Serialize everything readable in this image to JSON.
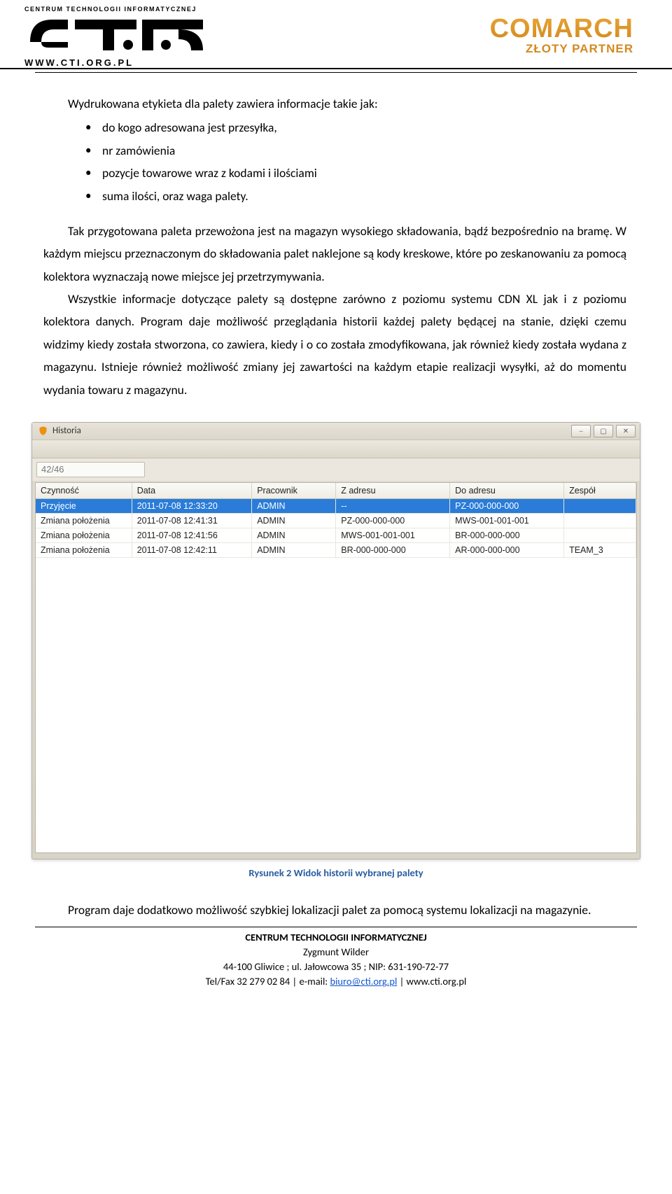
{
  "header": {
    "left_top": "CENTRUM TECHNOLOGII INFORMATYCZNEJ",
    "left_bottom": "WWW.CTI.ORG.PL",
    "right_brand": "COMARCH",
    "right_sub": "ZŁOTY PARTNER"
  },
  "body": {
    "p1": "Wydrukowana etykieta dla palety zawiera informacje takie jak:",
    "bullets": [
      "do kogo adresowana jest przesyłka,",
      "nr zamówienia",
      "pozycje towarowe wraz z kodami i ilościami",
      "suma ilości, oraz waga palety."
    ],
    "p2": "Tak przygotowana paleta przewożona jest na magazyn wysokiego składowania, bądź bezpośrednio na bramę. W każdym miejscu przeznaczonym do składowania palet naklejone są kody kreskowe, które po zeskanowaniu za pomocą kolektora wyznaczają nowe miejsce jej przetrzymywania.",
    "p3": "Wszystkie informacje dotyczące palety są dostępne zarówno z poziomu systemu CDN XL jak i z poziomu kolektora danych. Program daje możliwość przeglądania historii każdej palety będącej na stanie, dzięki czemu widzimy kiedy została stworzona, co zawiera, kiedy i o co została zmodyfikowana, jak również kiedy została wydana z magazynu. Istnieje również możliwość zmiany jej zawartości na każdym etapie realizacji wysyłki, aż do momentu wydania towaru z magazynu."
  },
  "window": {
    "title": "Historia",
    "filter_value": "42/46",
    "columns": [
      "Czynność",
      "Data",
      "Pracownik",
      "Z adresu",
      "Do adresu",
      "Zespół"
    ],
    "rows": [
      {
        "sel": true,
        "cells": [
          "Przyjęcie",
          "2011-07-08 12:33:20",
          "ADMIN",
          "--",
          "PZ-000-000-000",
          ""
        ]
      },
      {
        "sel": false,
        "cells": [
          "Zmiana położenia",
          "2011-07-08 12:41:31",
          "ADMIN",
          "PZ-000-000-000",
          "MWS-001-001-001",
          ""
        ]
      },
      {
        "sel": false,
        "cells": [
          "Zmiana położenia",
          "2011-07-08 12:41:56",
          "ADMIN",
          "MWS-001-001-001",
          "BR-000-000-000",
          ""
        ]
      },
      {
        "sel": false,
        "cells": [
          "Zmiana położenia",
          "2011-07-08 12:42:11",
          "ADMIN",
          "BR-000-000-000",
          "AR-000-000-000",
          "TEAM_3"
        ]
      }
    ],
    "caption": "Rysunek 2 Widok historii wybranej palety"
  },
  "after": {
    "p": "Program daje dodatkowo możliwość szybkiej lokalizacji palet za pomocą systemu lokalizacji na magazynie."
  },
  "footer": {
    "l1": "CENTRUM TECHNOLOGII INFORMATYCZNEJ",
    "l2": "Zygmunt Wilder",
    "l3": "44-100 Gliwice ; ul. Jałowcowa 35 ; NIP: 631-190-72-77",
    "l4a": "Tel/Fax 32 279 02 84 | e-mail: ",
    "l4_link": "biuro@cti.org.pl",
    "l4b": " | www.cti.org.pl"
  }
}
